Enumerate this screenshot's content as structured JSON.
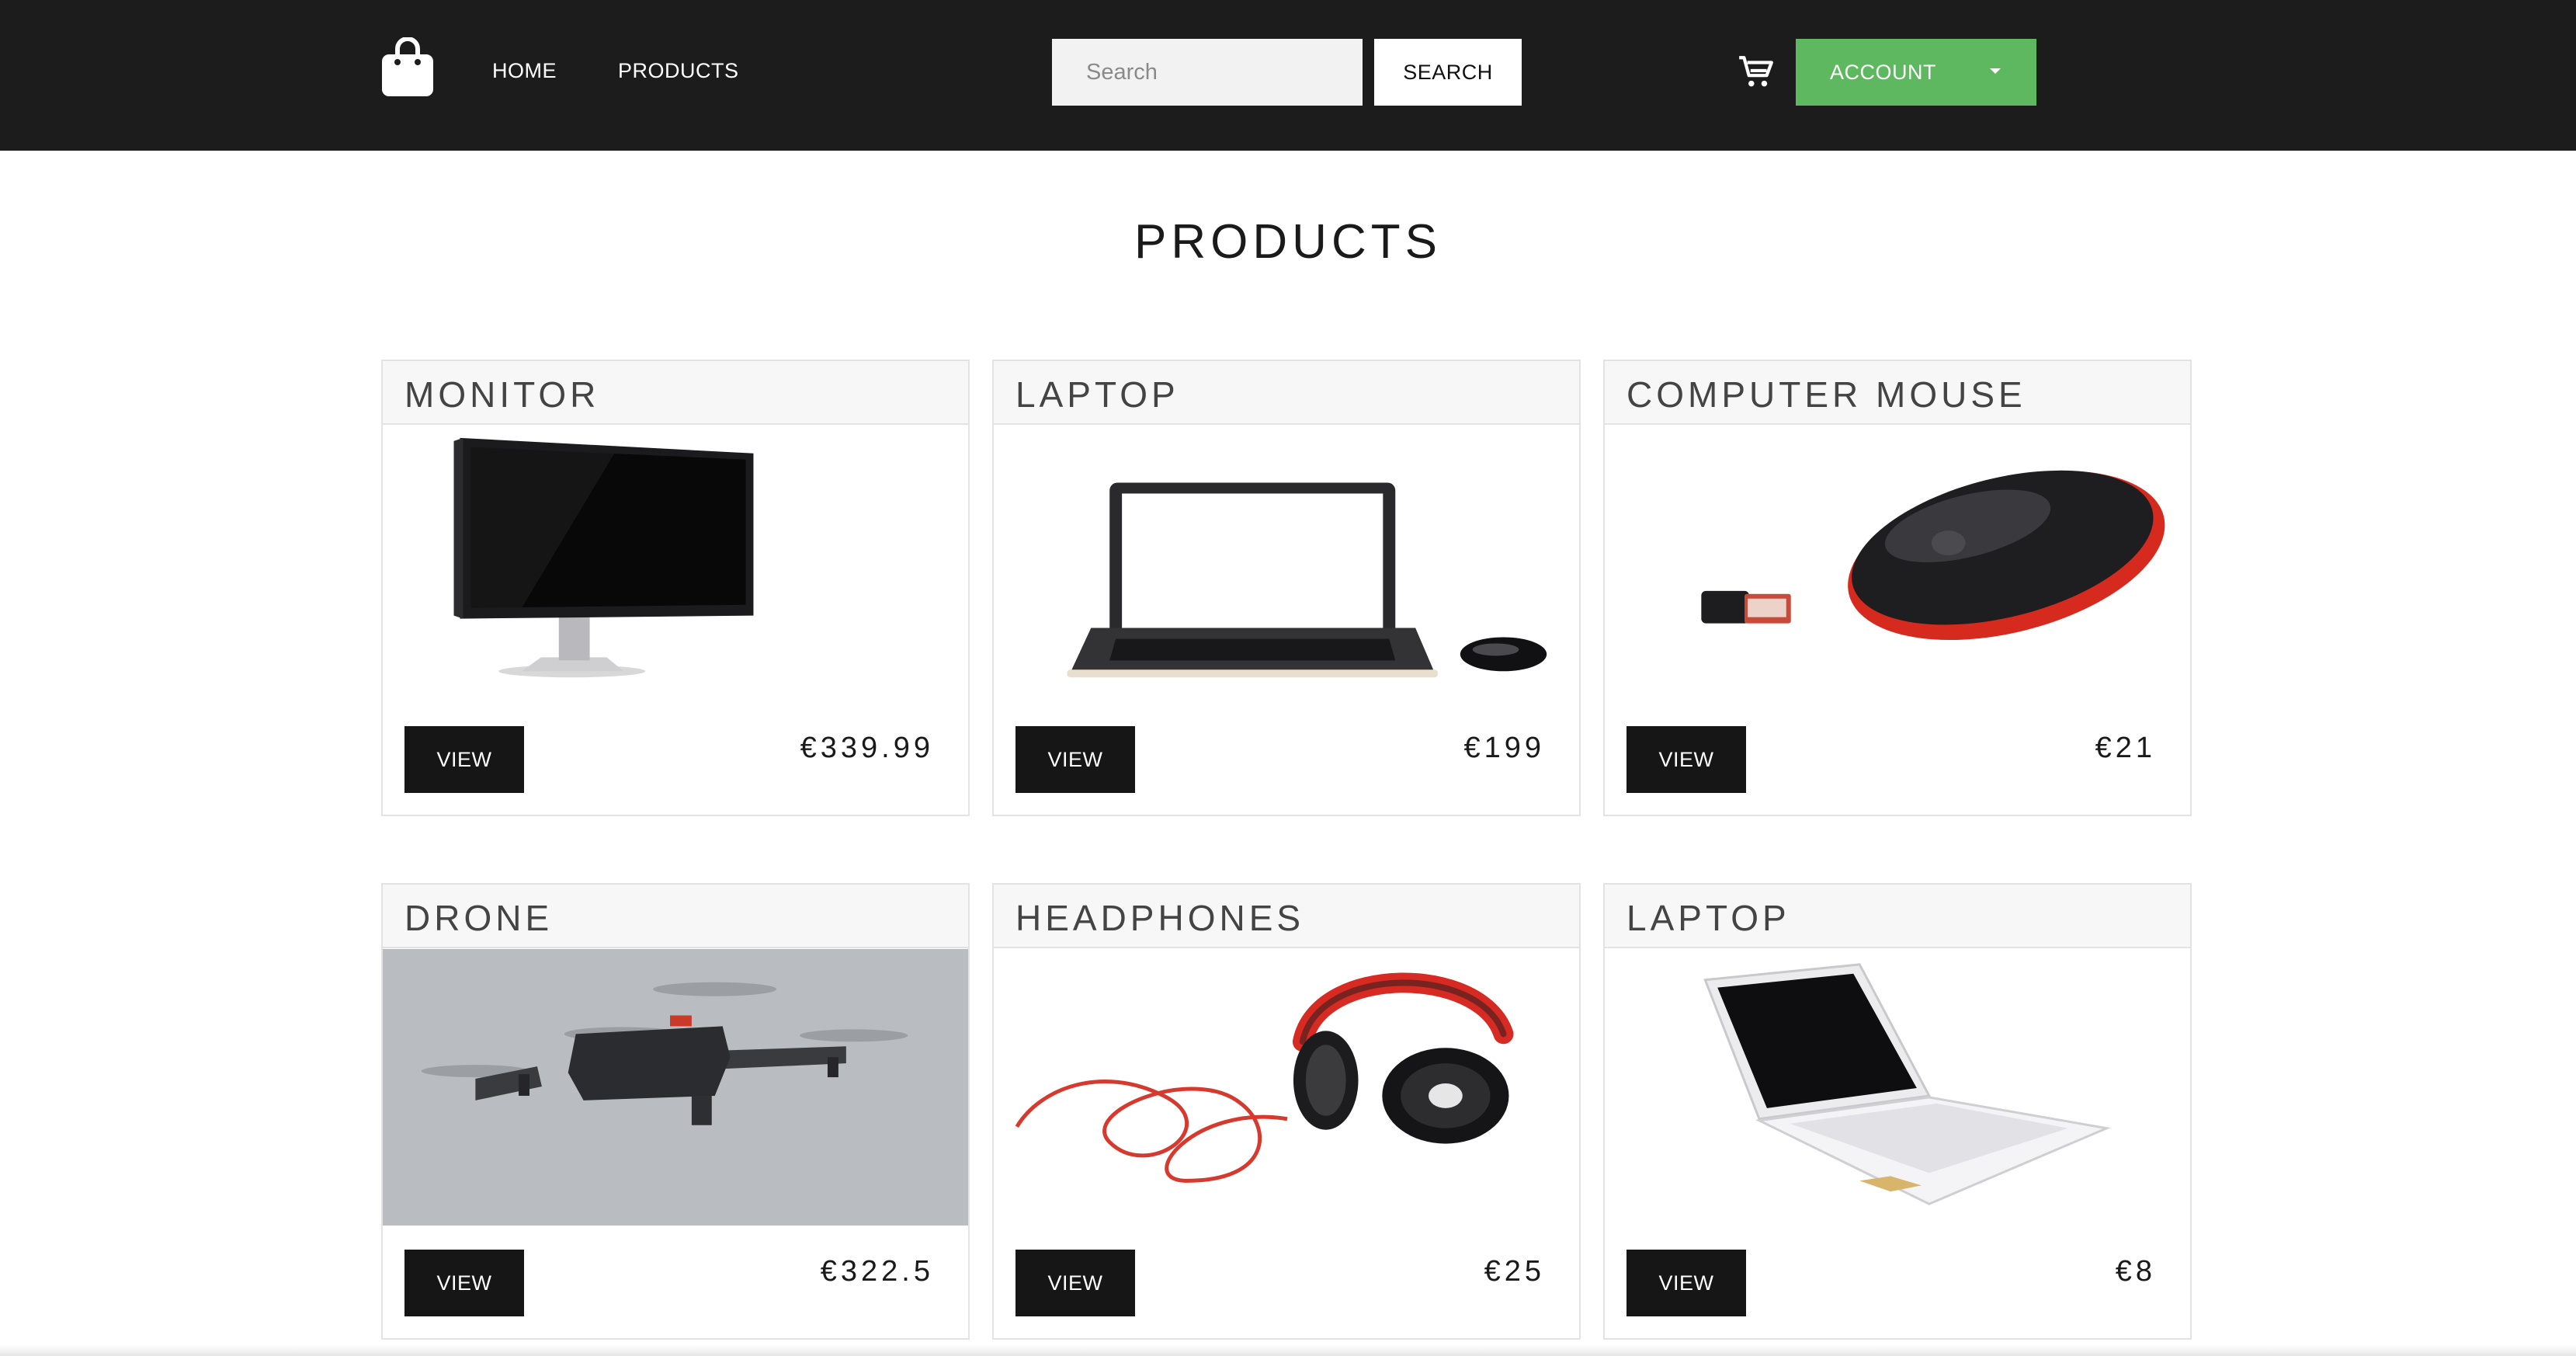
{
  "navbar": {
    "logo_icon": "shopping-bag-icon",
    "links": [
      "HOME",
      "PRODUCTS"
    ],
    "search": {
      "placeholder": "Search",
      "value": "",
      "button_label": "SEARCH"
    },
    "cart_icon": "cart-icon",
    "account": {
      "label": "ACCOUNT",
      "icon": "caret-down-icon"
    }
  },
  "page": {
    "title": "PRODUCTS"
  },
  "products": [
    {
      "name": "MONITOR",
      "price": "€339.99",
      "view_label": "VIEW",
      "image": "monitor"
    },
    {
      "name": "LAPTOP",
      "price": "€199",
      "view_label": "VIEW",
      "image": "laptop-with-mouse"
    },
    {
      "name": "COMPUTER MOUSE",
      "price": "€21",
      "view_label": "VIEW",
      "image": "wireless-mouse-with-usb-receiver"
    },
    {
      "name": "DRONE",
      "price": "€322.5",
      "view_label": "VIEW",
      "image": "drone-in-sky"
    },
    {
      "name": "HEADPHONES",
      "price": "€25",
      "view_label": "VIEW",
      "image": "headphones"
    },
    {
      "name": "LAPTOP",
      "price": "€8",
      "view_label": "VIEW",
      "image": "white-netbook"
    }
  ],
  "colors": {
    "navbar_bg": "#1c1c1c",
    "account_green": "#5db85f",
    "view_button_bg": "#161616",
    "card_header_bg": "#f7f7f7"
  }
}
